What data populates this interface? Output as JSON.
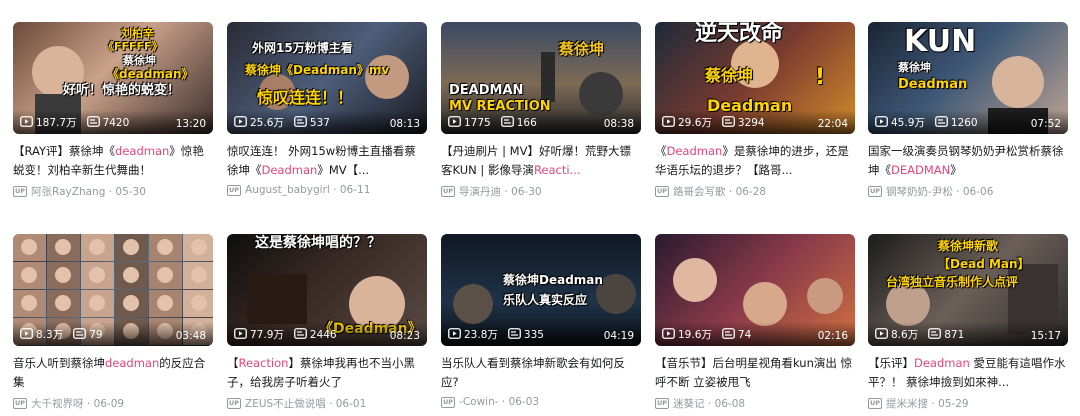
{
  "colors": {
    "title": "#18191c",
    "highlight": "#e3447b",
    "meta": "#9499a0",
    "overlay_yellow": "#ffd400"
  },
  "icons": {
    "play": "play-count-icon",
    "danmaku": "danmaku-count-icon",
    "up": "up-badge-icon"
  },
  "videos": [
    {
      "views": "187.7万",
      "danmaku": "7420",
      "duration": "13:20",
      "title_parts": [
        {
          "text": "【RAY评】蔡徐坤《",
          "hl": false
        },
        {
          "text": "deadman",
          "hl": true
        },
        {
          "text": "》惊艳蜕变！刘柏辛新生代舞曲！",
          "hl": false
        }
      ],
      "author": "阿张RayZhang",
      "date": "05-30",
      "overlays": [
        "刘柏辛",
        "《FFFFF》",
        "蔡徐坤",
        "《deadman》",
        "好听！惊艳的蜕变！"
      ]
    },
    {
      "views": "25.6万",
      "danmaku": "537",
      "duration": "08:13",
      "title_parts": [
        {
          "text": "惊叹连连！ 外网15w粉博主直播看蔡徐坤《",
          "hl": false
        },
        {
          "text": "Deadman",
          "hl": true
        },
        {
          "text": "》MV【...",
          "hl": false
        }
      ],
      "author": "August_babygirl",
      "date": "06-11",
      "overlays": [
        "外网15万粉博主看",
        "蔡徐坤《Deadman》mv",
        "惊叹连连！！"
      ]
    },
    {
      "views": "1775",
      "danmaku": "166",
      "duration": "08:38",
      "title_parts": [
        {
          "text": "【丹迪刷片 | MV】好听爆！荒野大镖客KUN | 影像导演",
          "hl": false
        },
        {
          "text": "Reacti...",
          "hl": true
        }
      ],
      "author": "导演丹迪",
      "date": "06-30",
      "overlays": [
        "蔡徐坤",
        "DEADMAN",
        "MV REACTION"
      ]
    },
    {
      "views": "29.6万",
      "danmaku": "3294",
      "duration": "22:04",
      "title_parts": [
        {
          "text": "《",
          "hl": false
        },
        {
          "text": "Deadman",
          "hl": true
        },
        {
          "text": "》是蔡徐坤的进步，还是华语乐坛的退步？【路哥...",
          "hl": false
        }
      ],
      "author": "路哥会写歌",
      "date": "06-28",
      "overlays": [
        "逆天改命",
        "蔡徐坤",
        "Deadman",
        "!"
      ]
    },
    {
      "views": "45.9万",
      "danmaku": "1260",
      "duration": "07:52",
      "title_parts": [
        {
          "text": "国家一级演奏员钢琴奶奶尹松赏析蔡徐坤《",
          "hl": false
        },
        {
          "text": "DEADMAN",
          "hl": true
        },
        {
          "text": "》",
          "hl": false
        }
      ],
      "author": "钢琴奶奶-尹松",
      "date": "06-06",
      "overlays": [
        "KUN",
        "蔡徐坤",
        "Deadman"
      ]
    },
    {
      "views": "8.3万",
      "danmaku": "79",
      "duration": "03:48",
      "title_parts": [
        {
          "text": "音乐人听到蔡徐坤",
          "hl": false
        },
        {
          "text": "deadman",
          "hl": true
        },
        {
          "text": "的反应合集",
          "hl": false
        }
      ],
      "author": "大千视界呀",
      "date": "06-09",
      "overlays": []
    },
    {
      "views": "77.9万",
      "danmaku": "2446",
      "duration": "08:23",
      "title_parts": [
        {
          "text": "【",
          "hl": false
        },
        {
          "text": "Reaction",
          "hl": true
        },
        {
          "text": "】蔡徐坤我再也不当小黑子，给我房子听着火了",
          "hl": false
        }
      ],
      "author": "ZEUS不止做说唱",
      "date": "06-01",
      "overlays": [
        "这是蔡徐坤唱的？？",
        "《Deadman》"
      ]
    },
    {
      "views": "23.8万",
      "danmaku": "335",
      "duration": "04:19",
      "title_parts": [
        {
          "text": "当乐队人看到蔡徐坤新歌会有如何反应?",
          "hl": false
        }
      ],
      "author": "-Cowin-",
      "date": "06-03",
      "overlays": [
        "蔡徐坤Deadman",
        "乐队人真实反应"
      ]
    },
    {
      "views": "19.6万",
      "danmaku": "74",
      "duration": "02:16",
      "title_parts": [
        {
          "text": "【音乐节】后台明星视角看kun演出 惊呼不断 立姿被甩飞",
          "hl": false
        }
      ],
      "author": "迷葵记",
      "date": "06-08",
      "overlays": []
    },
    {
      "views": "8.6万",
      "danmaku": "871",
      "duration": "15:17",
      "title_parts": [
        {
          "text": "【乐评】",
          "hl": false
        },
        {
          "text": "Deadman",
          "hl": true
        },
        {
          "text": " 愛豆能有這唱作水平？！ 蔡徐坤撿到如來神...",
          "hl": false
        }
      ],
      "author": "提米米搜",
      "date": "05-29",
      "overlays": [
        "蔡徐坤新歌",
        "【Dead Man】",
        "台湾独立音乐制作人点评"
      ]
    }
  ]
}
